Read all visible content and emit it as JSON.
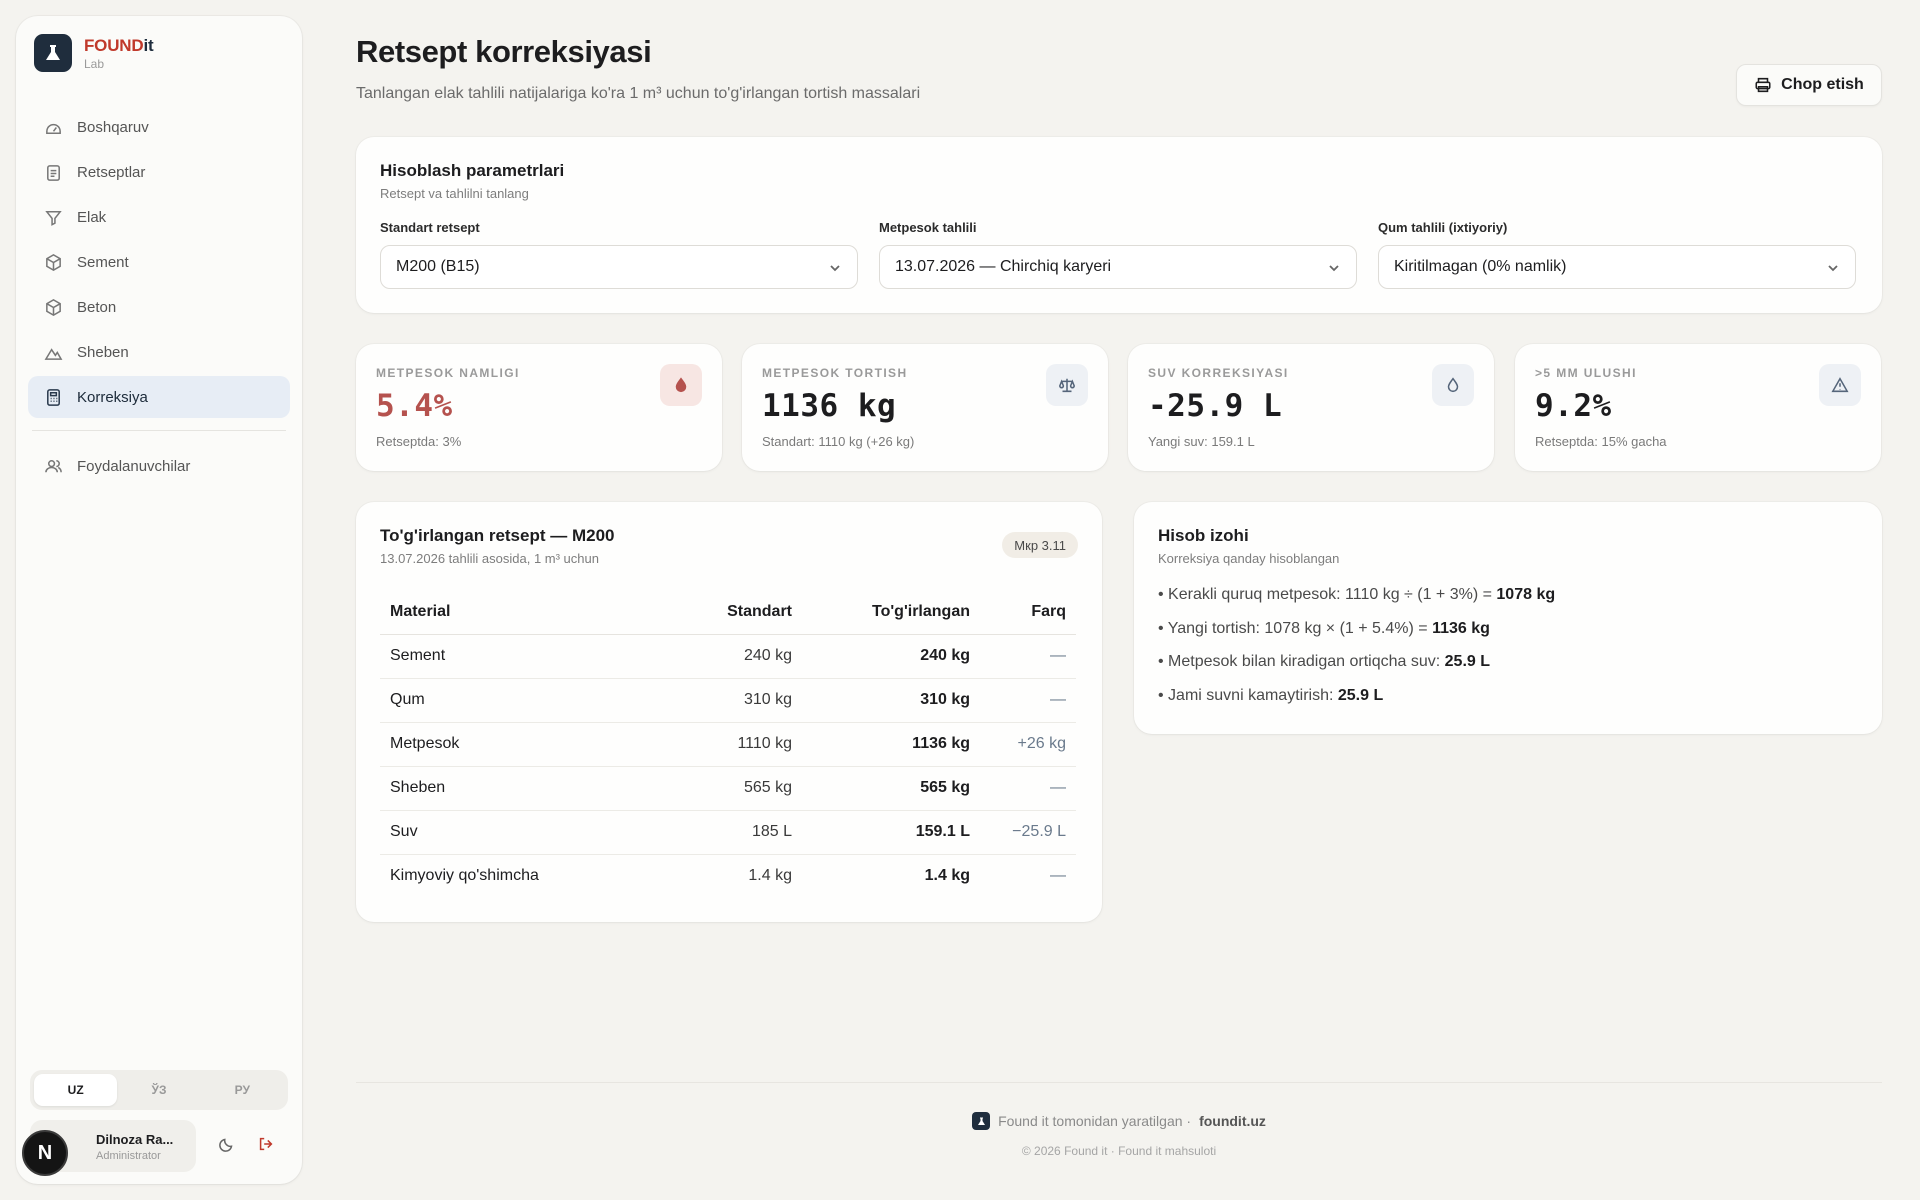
{
  "brand": {
    "name_red": "FOUND",
    "name_dark": "it",
    "subtitle": "Lab"
  },
  "nav": {
    "items": [
      {
        "label": "Boshqaruv",
        "icon": "dashboard-icon"
      },
      {
        "label": "Retseptlar",
        "icon": "clipboard-icon"
      },
      {
        "label": "Elak",
        "icon": "filter-icon"
      },
      {
        "label": "Sement",
        "icon": "box-icon"
      },
      {
        "label": "Beton",
        "icon": "cube-icon"
      },
      {
        "label": "Sheben",
        "icon": "mountain-icon"
      },
      {
        "label": "Korreksiya",
        "icon": "calculator-icon",
        "active": true
      },
      {
        "label": "Foydalanuvchilar",
        "icon": "users-icon"
      }
    ]
  },
  "languages": {
    "items": [
      "UZ",
      "ЎЗ",
      "РУ"
    ],
    "active": "UZ"
  },
  "user": {
    "initial": "N",
    "name": "Dilnoza Ra...",
    "role": "Administrator"
  },
  "header": {
    "title": "Retsept korreksiyasi",
    "subtitle": "Tanlangan elak tahlili natijalariga ko'ra 1 m³ uchun to'g'irlangan tortish massalari",
    "print_label": "Chop etish"
  },
  "params": {
    "title": "Hisoblash parametrlari",
    "subtitle": "Retsept va tahlilni tanlang",
    "fields": [
      {
        "label": "Standart retsept",
        "value": "M200 (B15)"
      },
      {
        "label": "Metpesok tahlili",
        "value": "13.07.2026 — Chirchiq karyeri"
      },
      {
        "label": "Qum tahlili (ixtiyoriy)",
        "value": "Kiritilmagan (0% namlik)"
      }
    ]
  },
  "stats": [
    {
      "label": "METPESOK NAMLIGI",
      "value": "5.4%",
      "note": "Retseptda: 3%",
      "icon": "droplet-filled-icon"
    },
    {
      "label": "METPESOK TORTISH",
      "value": "1136 kg",
      "note": "Standart: 1110 kg (+26 kg)",
      "icon": "scale-icon"
    },
    {
      "label": "SUV KORREKSIYASI",
      "value": "-25.9 L",
      "note": "Yangi suv: 159.1 L",
      "icon": "droplet-icon"
    },
    {
      "label": ">5 MM ULUSHI",
      "value": "9.2%",
      "note": "Retseptda: 15% gacha",
      "icon": "warning-icon"
    }
  ],
  "recipe": {
    "title": "To'g'irlangan retsept — M200",
    "subtitle": "13.07.2026 tahlili asosida, 1 m³ uchun",
    "badge": "Мкр 3.11",
    "columns": [
      "Material",
      "Standart",
      "To'g'irlangan",
      "Farq"
    ],
    "rows": [
      [
        "Sement",
        "240 kg",
        "240 kg",
        "—"
      ],
      [
        "Qum",
        "310 kg",
        "310 kg",
        "—"
      ],
      [
        "Metpesok",
        "1110 kg",
        "1136 kg",
        "+26 kg"
      ],
      [
        "Sheben",
        "565 kg",
        "565 kg",
        "—"
      ],
      [
        "Suv",
        "185 L",
        "159.1 L",
        "−25.9 L"
      ],
      [
        "Kimyoviy qo'shimcha",
        "1.4 kg",
        "1.4 kg",
        "—"
      ]
    ]
  },
  "explanation": {
    "title": "Hisob izohi",
    "subtitle": "Korreksiya qanday hisoblangan",
    "lines": [
      {
        "text": "• Kerakli quruq metpesok: 1110 kg ÷ (1 + 3%) = ",
        "bold": "1078 kg"
      },
      {
        "text": "• Yangi tortish: 1078 kg × (1 + 5.4%) = ",
        "bold": "1136 kg"
      },
      {
        "text": "• Metpesok bilan kiradigan ortiqcha suv: ",
        "bold": "25.9 L"
      },
      {
        "text": "• Jami suvni kamaytirish: ",
        "bold": "25.9 L"
      }
    ]
  },
  "footer": {
    "made_by": "Found it tomonidan yaratilgan ·",
    "site": "foundit.uz",
    "copyright": "© 2026 Found it · Found it mahsuloti"
  },
  "colors": {
    "accent_red": "#c0392b",
    "brand_dark": "#1f2d3d",
    "active_nav_bg": "#e7edf5"
  }
}
